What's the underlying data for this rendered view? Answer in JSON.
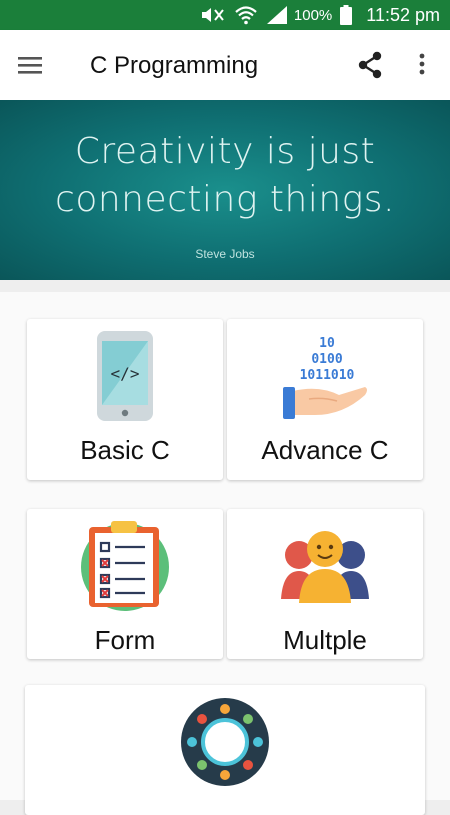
{
  "status_bar": {
    "battery": "100%",
    "time": "11:52 pm"
  },
  "app_bar": {
    "title": "C Programming"
  },
  "banner": {
    "quote_line1": "Creativity is just",
    "quote_line2": "connecting things.",
    "author": "Steve Jobs"
  },
  "cards": {
    "basic": {
      "label": "Basic C",
      "icon": "phone-code-icon",
      "screen_text": "</>"
    },
    "advance": {
      "label": "Advance C",
      "icon": "binary-hand-icon",
      "binary_lines": [
        "10",
        "0100",
        "1011010"
      ]
    },
    "form": {
      "label": "Form",
      "icon": "clipboard-checklist-icon"
    },
    "multiple": {
      "label": "Multple",
      "icon": "people-group-icon"
    },
    "fifth": {
      "label": "",
      "icon": "network-circle-icon"
    }
  },
  "colors": {
    "status_bar": "#1b7f3a",
    "banner": "#0f6f72",
    "accent_teal": "#76c9cc"
  }
}
